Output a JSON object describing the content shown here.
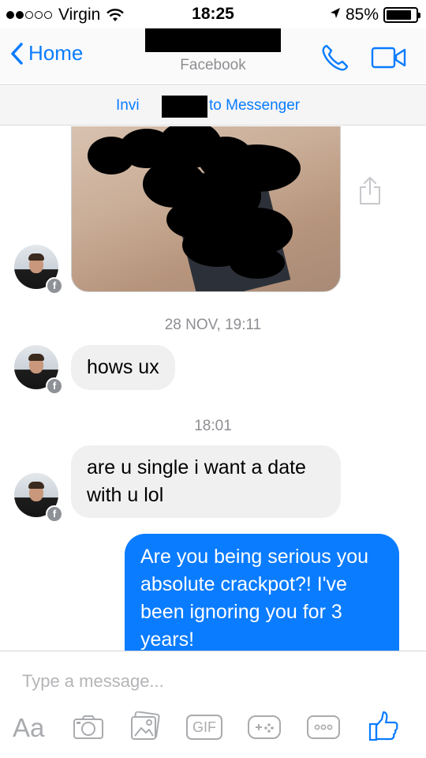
{
  "status_bar": {
    "carrier": "Virgin",
    "time": "18:25",
    "battery": "85%",
    "battery_level": 0.85
  },
  "nav": {
    "back_label": "Home",
    "subtitle": "Facebook"
  },
  "invite": {
    "left_text": "Invi",
    "right_text": "to Messenger"
  },
  "messages": [
    {
      "type": "timestamp",
      "text": "28 NOV, 19:11"
    },
    {
      "type": "incoming",
      "text": "hows ux"
    },
    {
      "type": "timestamp",
      "text": "18:01"
    },
    {
      "type": "incoming",
      "text": "are u single i want a date with u lol"
    },
    {
      "type": "outgoing",
      "text": "Are you being serious you absolute crackpot?! I've been ignoring you for 3 years!"
    }
  ],
  "composer": {
    "placeholder": "Type a message...",
    "aa_label": "Aa",
    "gif_label": "GIF"
  },
  "colors": {
    "accent": "#0a7cff",
    "incoming_bubble": "#f1f0f0",
    "icon_gray": "#a9abae"
  },
  "icons": [
    "back-chevron-icon",
    "phone-icon",
    "video-camera-icon",
    "share-icon",
    "camera-icon",
    "photo-gallery-icon",
    "gif-icon",
    "game-controller-icon",
    "more-icon",
    "thumbs-up-icon",
    "facebook-badge-icon",
    "wifi-icon",
    "location-arrow-icon"
  ]
}
